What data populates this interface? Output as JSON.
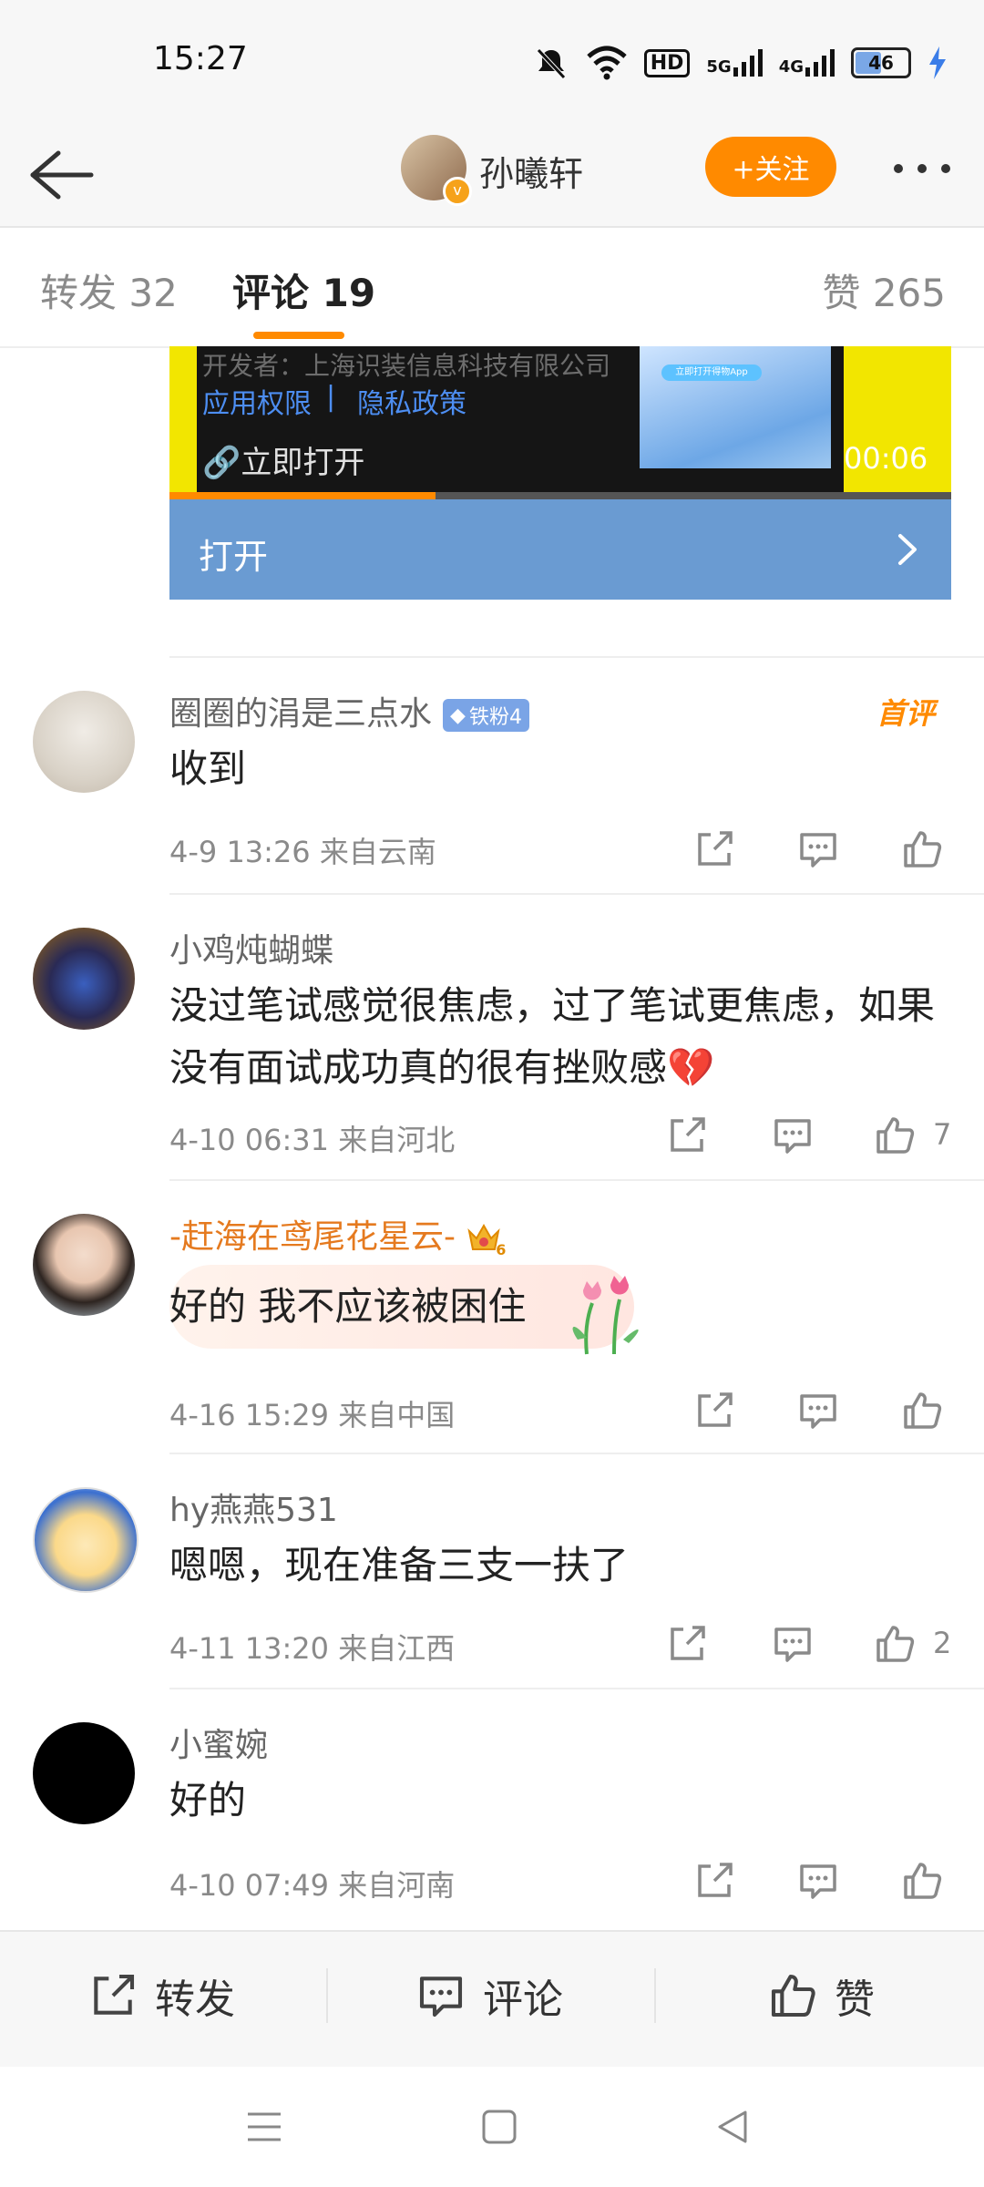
{
  "status_bar": {
    "time": "15:27",
    "net_5g": "5G",
    "net_4g": "4G",
    "hd_badge": "HD",
    "battery": "46",
    "icons": [
      "mute-icon",
      "wifi-icon",
      "hd-icon",
      "signal-5g-icon",
      "signal-4g-icon",
      "battery-icon",
      "charging-icon"
    ]
  },
  "header": {
    "user_name": "孙曦轩",
    "follow_label": "+关注"
  },
  "tabs": [
    {
      "label": "转发 32"
    },
    {
      "label": "评论 19"
    },
    {
      "label": "赞 265"
    }
  ],
  "ad_card": {
    "developer": "开发者：上海识装信息科技有限公司",
    "app_permission": "应用权限",
    "separator": "|",
    "privacy_policy": "隐私政策",
    "open_now": "立即打开",
    "video_time": "00:06",
    "thumb_button": "立即打开得物App",
    "open_bar_label": "打开",
    "progress_fraction": 0.34
  },
  "comments": [
    {
      "name": "圈圈的涓是三点水",
      "badge": "铁粉4",
      "first_label": "首评",
      "text": "收到",
      "meta": "4-9 13:26  来自云南",
      "likes": ""
    },
    {
      "name": "小鸡炖蝴蝶",
      "text": "没过笔试感觉很焦虑，过了笔试更焦虑，如果没有面试成功真的很有挫败感💔",
      "meta": "4-10 06:31  来自河北",
      "likes": "7"
    },
    {
      "name": "-赶海在鸢尾花星云-",
      "level_badge": "6",
      "text": "好的 我不应该被困住",
      "meta": "4-16 15:29  来自中国",
      "likes": ""
    },
    {
      "name": "hy燕燕531",
      "text": "嗯嗯，现在准备三支一扶了",
      "meta": "4-11 13:20  来自江西",
      "likes": "2"
    },
    {
      "name": "小蜜婉",
      "text": "好的",
      "meta": "4-10 07:49  来自河南",
      "likes": ""
    }
  ],
  "bottom_bar": {
    "repost": "转发",
    "comment": "评论",
    "like": "赞"
  },
  "colors": {
    "accent": "#ff8a00",
    "link": "#4d8ef2",
    "open_bar": "#6a9bd2"
  }
}
